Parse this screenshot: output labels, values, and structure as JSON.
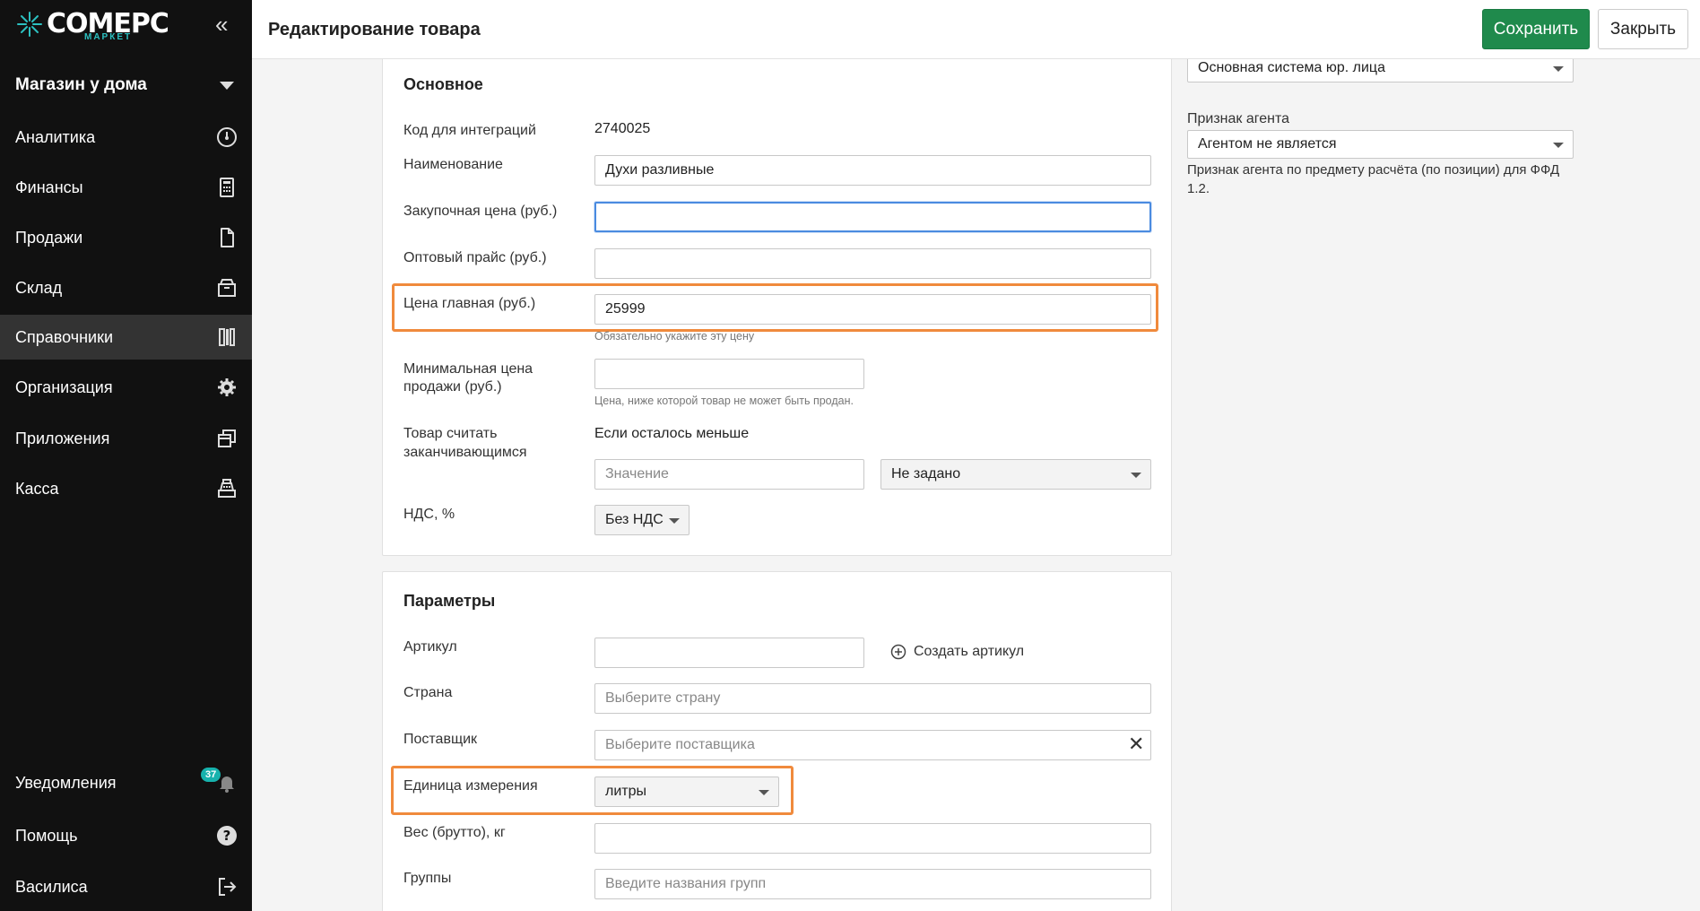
{
  "app": {
    "logo_text": "COMEPC",
    "logo_sub": "МАРКЕТ",
    "store_name": "Магазин у дома"
  },
  "sidebar": {
    "items": [
      {
        "label": "Аналитика",
        "icon": "dashboard-gauge-icon"
      },
      {
        "label": "Финансы",
        "icon": "calculator-icon"
      },
      {
        "label": "Продажи",
        "icon": "document-icon"
      },
      {
        "label": "Склад",
        "icon": "box-icon"
      },
      {
        "label": "Справочники",
        "icon": "books-icon",
        "active": true
      },
      {
        "label": "Организация",
        "icon": "gear-icon"
      },
      {
        "label": "Приложения",
        "icon": "windows-stack-icon"
      },
      {
        "label": "Касса",
        "icon": "cash-register-icon"
      }
    ],
    "bottom": [
      {
        "label": "Уведомления",
        "icon": "bell-icon",
        "badge": "37"
      },
      {
        "label": "Помощь",
        "icon": "help-circle-icon"
      },
      {
        "label": "Василиса",
        "icon": "logout-icon"
      }
    ]
  },
  "header": {
    "title": "Редактирование товара",
    "save_label": "Сохранить",
    "close_label": "Закрыть"
  },
  "main_section": {
    "title": "Основное",
    "integration_code_label": "Код для интеграций",
    "integration_code_value": "2740025",
    "name_label": "Наименование",
    "name_value": "Духи разливные",
    "purchase_price_label": "Закупочная цена (руб.)",
    "purchase_price_value": "",
    "wholesale_price_label": "Оптовый прайс (руб.)",
    "wholesale_price_value": "",
    "main_price_label": "Цена главная (руб.)",
    "main_price_value": "25999",
    "main_price_help": "Обязательно укажите эту цену",
    "min_price_label_1": "Минимальная цена",
    "min_price_label_2": "продажи (руб.)",
    "min_price_value": "",
    "min_price_help": "Цена, ниже которой товар не может быть продан.",
    "low_stock_label_1": "Товар считать",
    "low_stock_label_2": "заканчивающимся",
    "low_stock_text": "Если осталось меньше",
    "low_stock_placeholder": "Значение",
    "low_stock_unit": "Не задано",
    "vat_label": "НДС, %",
    "vat_value": "Без НДС"
  },
  "params_section": {
    "title": "Параметры",
    "article_label": "Артикул",
    "article_value": "",
    "create_article_label": "Создать артикул",
    "country_label": "Страна",
    "country_placeholder": "Выберите страну",
    "supplier_label": "Поставщик",
    "supplier_placeholder": "Выберите поставщика",
    "unit_label": "Единица измерения",
    "unit_value": "литры",
    "weight_label": "Вес (брутто), кг",
    "weight_value": "",
    "groups_label": "Группы",
    "groups_placeholder": "Введите названия групп"
  },
  "right_panel": {
    "tax_system_value": "Основная система юр. лица",
    "agent_label": "Признак агента",
    "agent_value": "Агентом не является",
    "agent_help": "Признак агента по предмету расчёта (по позиции) для ФФД 1.2."
  },
  "colors": {
    "sidebar_bg": "#111111",
    "active_item_bg": "#333333",
    "save_button": "#1f8a4c",
    "highlight": "#f08a3c",
    "badge": "#17b2ad"
  }
}
